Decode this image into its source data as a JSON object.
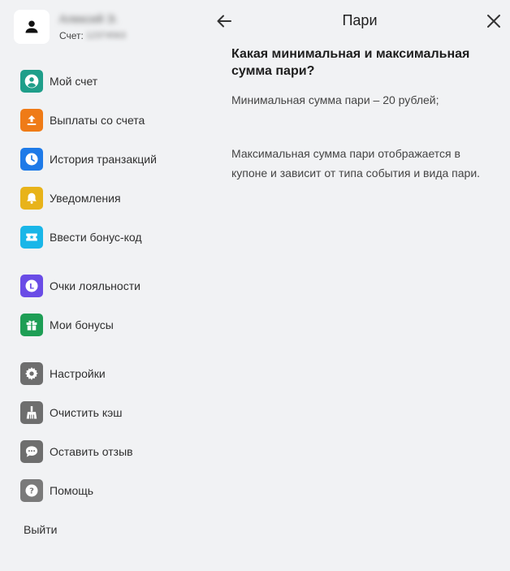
{
  "user": {
    "name": "Алексей Э.",
    "account_label": "Счет:",
    "account_number": "12374563"
  },
  "menu": {
    "items": [
      {
        "label": "Мой счет",
        "icon": "account-icon",
        "color": "#1f9e8a"
      },
      {
        "label": "Выплаты со счета",
        "icon": "withdraw-icon",
        "color": "#ef7b17"
      },
      {
        "label": "История транзакций",
        "icon": "clock-icon",
        "color": "#1e7ae8"
      },
      {
        "label": "Уведомления",
        "icon": "bell-icon",
        "color": "#e8b31a"
      },
      {
        "label": "Ввести бонус-код",
        "icon": "ticket-icon",
        "color": "#19b6e8"
      },
      {
        "label": "Очки лояльности",
        "icon": "loyalty-icon",
        "color": "#6a4ce6"
      },
      {
        "label": "Мои бонусы",
        "icon": "gift-icon",
        "color": "#1e9e55"
      },
      {
        "label": "Настройки",
        "icon": "gear-icon",
        "color": "#6e6e6e"
      },
      {
        "label": "Очистить кэш",
        "icon": "broom-icon",
        "color": "#6e6e6e"
      },
      {
        "label": "Оставить отзыв",
        "icon": "chat-icon",
        "color": "#6e6e6e"
      },
      {
        "label": "Помощь",
        "icon": "help-icon",
        "color": "#7a7a7a"
      }
    ],
    "logout_label": "Выйти"
  },
  "header": {
    "title": "Пари",
    "back_icon": "arrow-left-icon",
    "close_icon": "close-icon"
  },
  "article": {
    "question": "Какая минимальная и максимальная сумма пари?",
    "answer_min": "Минимальная сумма пари – 20 рублей;",
    "answer_max": "Максимальная сумма пари отображается в купоне и зависит от типа события и вида пари."
  }
}
